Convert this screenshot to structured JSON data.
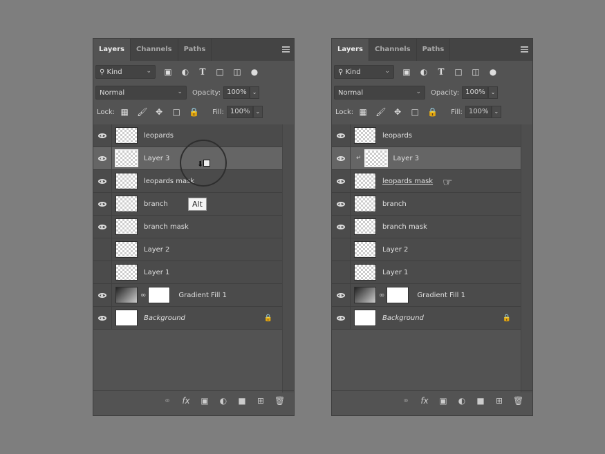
{
  "panels": [
    {
      "tabs": [
        "Layers",
        "Channels",
        "Paths"
      ],
      "filter": "Kind",
      "blend_mode": "Normal",
      "opacity_label": "Opacity:",
      "opacity": "100%",
      "lock_label": "Lock:",
      "fill_label": "Fill:",
      "fill": "100%",
      "layers": [
        {
          "name": "leopards",
          "visible": true,
          "thumb": "checker"
        },
        {
          "name": "Layer 3",
          "visible": true,
          "thumb": "checker",
          "selected": true
        },
        {
          "name": "leopards mask",
          "visible": true,
          "thumb": "checker"
        },
        {
          "name": "branch",
          "visible": true,
          "thumb": "checker"
        },
        {
          "name": "branch mask",
          "visible": true,
          "thumb": "checker"
        },
        {
          "name": "Layer 2",
          "visible": false,
          "thumb": "checker"
        },
        {
          "name": "Layer 1",
          "visible": false,
          "thumb": "checker"
        },
        {
          "name": "Gradient Fill 1",
          "visible": true,
          "thumb": "gradient",
          "mask": true
        },
        {
          "name": "Background",
          "visible": true,
          "thumb": "white",
          "italic": true,
          "locked": true
        }
      ],
      "tooltip": "Alt"
    },
    {
      "tabs": [
        "Layers",
        "Channels",
        "Paths"
      ],
      "filter": "Kind",
      "blend_mode": "Normal",
      "opacity_label": "Opacity:",
      "opacity": "100%",
      "lock_label": "Lock:",
      "fill_label": "Fill:",
      "fill": "100%",
      "layers": [
        {
          "name": "leopards",
          "visible": true,
          "thumb": "checker"
        },
        {
          "name": "Layer 3",
          "visible": true,
          "thumb": "checker",
          "selected": true,
          "clipped": true
        },
        {
          "name": "leopards mask",
          "visible": true,
          "thumb": "checker",
          "underlined": true
        },
        {
          "name": "branch",
          "visible": true,
          "thumb": "checker"
        },
        {
          "name": "branch mask",
          "visible": true,
          "thumb": "checker"
        },
        {
          "name": "Layer 2",
          "visible": false,
          "thumb": "checker"
        },
        {
          "name": "Layer 1",
          "visible": false,
          "thumb": "checker"
        },
        {
          "name": "Gradient Fill 1",
          "visible": true,
          "thumb": "gradient",
          "mask": true
        },
        {
          "name": "Background",
          "visible": true,
          "thumb": "white",
          "italic": true,
          "locked": true
        }
      ]
    }
  ]
}
